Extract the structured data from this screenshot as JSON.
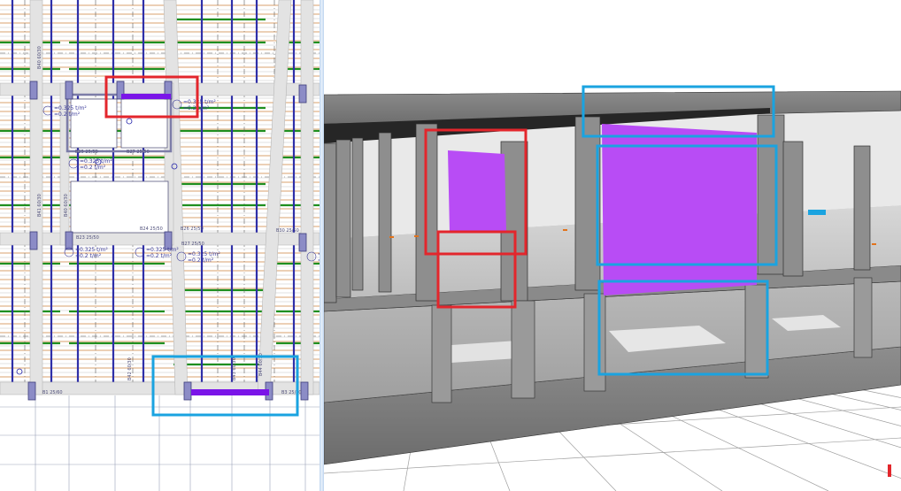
{
  "plan": {
    "load_tags": [
      {
        "line1": "=0.325 t/m²",
        "line2": "=0.2 t/m²"
      },
      {
        "line1": "=0.325 t/m²",
        "line2": "=0.2 t/m²"
      },
      {
        "line1": "=0.325 t/m²",
        "line2": "=0.2 t/m²"
      },
      {
        "line1": "=0.325 t/m²",
        "line2": "=0.2 t/m²"
      },
      {
        "line1": "=0.325 t/m²",
        "line2": "=0.2 t/m²"
      },
      {
        "line1": "=0.325 t/m²",
        "line2": "=0.2 t/m²"
      },
      {
        "line1": "=0.325 t/m²",
        "line2": "=0.2 t/m²"
      }
    ],
    "beam_labels": [
      "B25 25/50",
      "B27 25/50",
      "B23 25/50",
      "B24 25/50",
      "B26 25/50",
      "B27 25/50",
      "B30 25/50"
    ],
    "vertical_labels": [
      "B40 60/30",
      "B40 60/30",
      "B41 60/30",
      "B42 60/30",
      "B43 60/30",
      "B44 60/30"
    ],
    "bottom_labels": [
      "B1 25/60",
      "B3 25/60"
    ]
  },
  "colors": {
    "highlight_red": "#e3262c",
    "highlight_blue": "#1aa3e0",
    "wall_purple": "#b84cf5",
    "wall_purple_plan": "#7a14e8",
    "beam_blue": "#2f2fa8",
    "beam_green": "#1f8f1f",
    "beam_orange": "#d9a16e",
    "concrete": "#8a8a8a"
  }
}
